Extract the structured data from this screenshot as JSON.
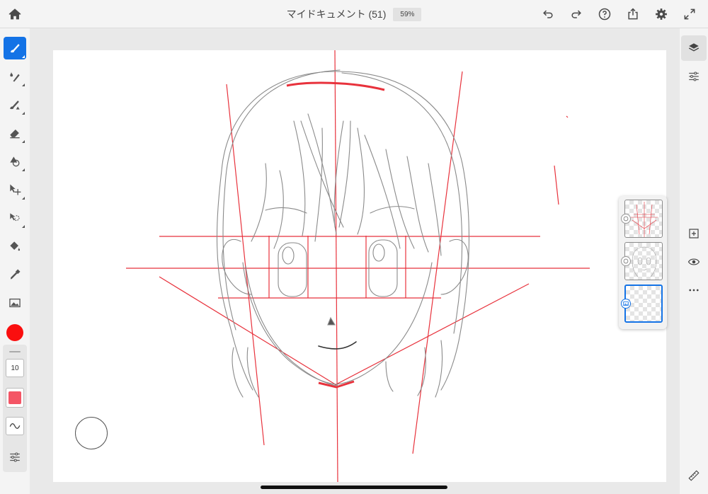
{
  "app": {
    "title": "マイドキュメント (51)",
    "zoom": "59%"
  },
  "toolbar_top": {
    "icons": [
      "home-icon",
      "undo-icon",
      "redo-icon",
      "help-icon",
      "share-icon",
      "settings-icon",
      "fullscreen-icon"
    ]
  },
  "tools": {
    "items": [
      "paint-brush-tool",
      "pixel-brush-tool",
      "vector-brush-tool",
      "eraser-tool",
      "shape-tool",
      "transform-tool",
      "selection-tool",
      "fill-tool",
      "eyedropper-tool",
      "image-tool"
    ],
    "active": "paint-brush-tool",
    "color": "#fa0f0f",
    "brush_size": "10",
    "opacity_color": "#f45565"
  },
  "right_rail": {
    "icons": [
      "layers-icon",
      "layer-properties-icon",
      "add-layer-icon",
      "visibility-icon",
      "more-icon",
      "ruler-icon"
    ]
  },
  "layers": {
    "count": 3,
    "selected_index": 2,
    "items": [
      "guide-lines-layer",
      "sketch-layer",
      "empty-layer"
    ]
  },
  "colors": {
    "accent": "#1473e6",
    "guide": "#e8323c",
    "sketch": "#7a7a7a"
  }
}
